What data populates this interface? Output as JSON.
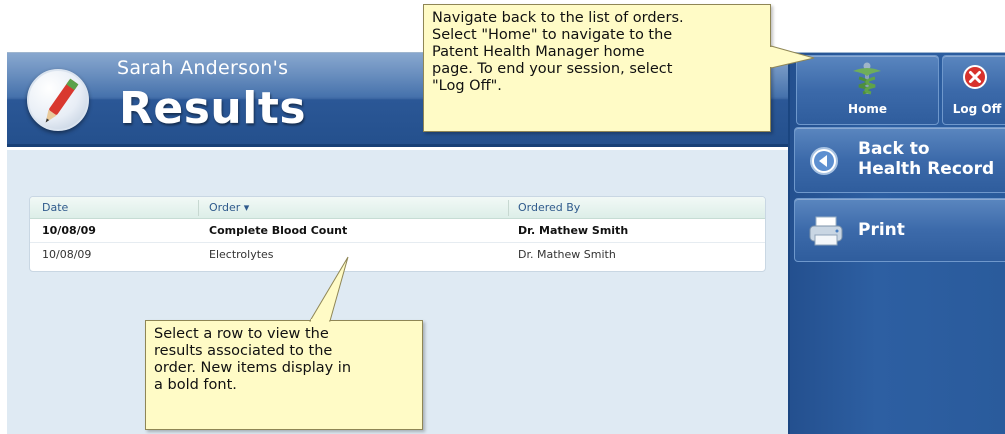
{
  "header": {
    "patient_name": "Sarah Anderson's",
    "title": "Results"
  },
  "grid": {
    "columns": [
      {
        "label": "Date"
      },
      {
        "label": "Order ▾"
      },
      {
        "label": "Ordered By"
      }
    ],
    "rows": [
      {
        "date": "10/08/09",
        "order": "Complete Blood Count",
        "ordered_by": "Dr. Mathew Smith",
        "is_new": true
      },
      {
        "date": "10/08/09",
        "order": "Electrolytes",
        "ordered_by": "Dr. Mathew Smith",
        "is_new": false
      }
    ]
  },
  "nav": {
    "home_label": "Home",
    "logoff_label": "Log Off",
    "back_label_line1": "Back to",
    "back_label_line2": "Health Record",
    "print_label": "Print"
  },
  "callouts": {
    "top_text": "Navigate back to the list of orders.\nSelect \"Home\" to navigate to the\nPatent Health Manager home\npage. To end your session, select\n\"Log Off\".",
    "bottom_text": "Select a row to view the\nresults associated to the\norder. New items display in\na bold font."
  },
  "colors": {
    "header_blue": "#2b5796",
    "content_bg": "#dfeaf3",
    "callout_bg": "#fffbc6",
    "link_blue": "#2f5a8c"
  }
}
